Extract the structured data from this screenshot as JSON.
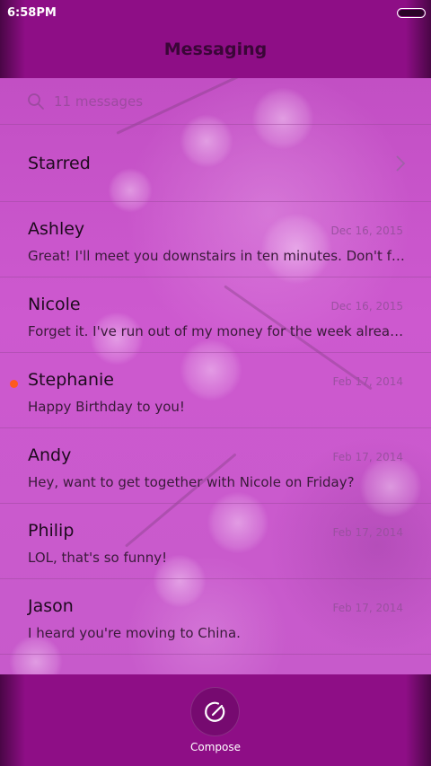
{
  "status": {
    "time": "6:58PM"
  },
  "header": {
    "title": "Messaging"
  },
  "search": {
    "text": "11 messages"
  },
  "starred": {
    "label": "Starred"
  },
  "messages": [
    {
      "name": "Ashley",
      "date": "Dec 16, 2015",
      "preview": "Great! I'll meet you downstairs in ten minutes. Don't forget your umbrella.",
      "unread": false
    },
    {
      "name": "Nicole",
      "date": "Dec 16, 2015",
      "preview": "Forget it. I've run out of my money for the week already.",
      "unread": false
    },
    {
      "name": "Stephanie",
      "date": "Feb 17, 2014",
      "preview": "Happy Birthday to you!",
      "unread": true
    },
    {
      "name": "Andy",
      "date": "Feb 17, 2014",
      "preview": "Hey, want to get together with Nicole on Friday?",
      "unread": false
    },
    {
      "name": "Philip",
      "date": "Feb 17, 2014",
      "preview": "LOL, that's so funny!",
      "unread": false
    },
    {
      "name": "Jason",
      "date": "Feb 17, 2014",
      "preview": "I heard you're moving to China.",
      "unread": false
    }
  ],
  "footer": {
    "compose_label": "Compose"
  },
  "colors": {
    "accent": "#8e0e86",
    "unread_dot": "#ff5a1e"
  }
}
